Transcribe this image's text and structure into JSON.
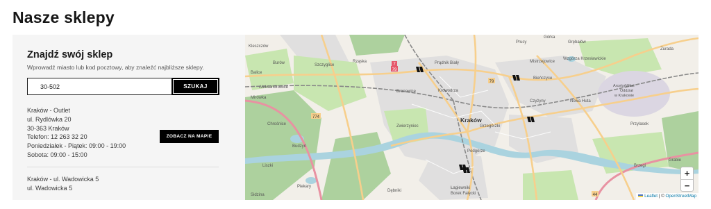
{
  "page": {
    "title": "Nasze sklepy"
  },
  "finder": {
    "title": "Znajdź swój sklep",
    "subtitle": "Wprowadź miasto lub kod pocztowy, aby znaleźć najbliższe sklepy.",
    "search_value": "30-502",
    "search_button": "SZUKAJ"
  },
  "stores": [
    {
      "name": "Kraków - Outlet",
      "street": "ul. Rydlówka 20",
      "postal_city": "30-363 Kraków",
      "phone": "Telefon: 12 263 32 20",
      "hours_week": "Poniedziałek - Piątek: 09:00 - 19:00",
      "hours_sat": "Sobota: 09:00 - 15:00",
      "map_button": "ZOBACZ NA MAPIE"
    },
    {
      "name": "Kraków - ul. Wadowicka 5",
      "street": "ul. Wadowicka 5"
    }
  ],
  "map": {
    "labels": {
      "city": "Kraków",
      "krowodrza": "Krowodrza",
      "pradnik": "Prądnik Biały",
      "bronowice": "Bronowice",
      "zwierzyniec": "Zwierzyniec",
      "grzegorzki": "Grzegórzki",
      "podgorze": "Podgórze",
      "czyzyny": "Czyżyny",
      "nowa_huta": "Nowa Huta",
      "bienczyce": "Bieńczyce",
      "mistrzejowice": "Mistrzejowice",
      "wzgorza": "Wzgórza Krzesławickie",
      "arcelor": "ArcelorMittal",
      "oddzial": "Oddział",
      "w_krakowie": "w Krakowie",
      "lagiewniki": "Łagiewniki",
      "borek": "Borek Fałęcki",
      "debniki": "Dębniki",
      "piekary": "Piekary",
      "liszki": "Liszki",
      "aleksandrowice": "Aleksandrowice",
      "kleszcow": "Kleszczów",
      "burow": "Burów",
      "balice": "Balice",
      "mirowka": "Mirówka",
      "chrosnice": "Chrośnice",
      "budzyn": "Budzyń",
      "rzaska": "Rząska",
      "szczyglice": "Szczyglice",
      "gorka": "Górka",
      "grebalow": "Grębałów",
      "prusy": "Prusy",
      "zurada": "Zurada",
      "przylasek": "Przylasek",
      "brzegi": "Brzegi",
      "grabie": "Grabie",
      "sidzina": "Sidzina",
      "r774": "774",
      "r79a": "79",
      "r79b": "79",
      "r7": "7",
      "r44": "44"
    },
    "zoom_in": "+",
    "zoom_out": "−",
    "attribution": {
      "leaflet": "Leaflet",
      "sep": " | © ",
      "osm": "OpenStreetMap"
    },
    "colors": {
      "water": "#aad3df",
      "park": "#c8e6b0",
      "forest": "#add19e",
      "residential": "#e0dfdf",
      "road_main": "#f7cf8c",
      "motorway": "#e892a2",
      "rail": "#888888"
    }
  }
}
